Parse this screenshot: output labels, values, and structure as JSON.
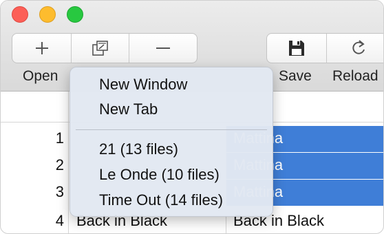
{
  "window": {
    "traffic_lights": [
      "close",
      "minimize",
      "zoom"
    ]
  },
  "toolbar": {
    "left_group": [
      {
        "name": "add",
        "icon": "plus-icon"
      },
      {
        "name": "open",
        "icon": "open-window-icon"
      },
      {
        "name": "remove",
        "icon": "minus-icon"
      }
    ],
    "right_group": [
      {
        "name": "save",
        "icon": "floppy-disk-icon"
      },
      {
        "name": "reload",
        "icon": "reload-icon"
      }
    ],
    "labels": {
      "open": "Open",
      "save": "Save",
      "reload": "Reload"
    }
  },
  "menu": {
    "items_top": [
      "New Window",
      "New Tab"
    ],
    "items_bottom": [
      "21 (13 files)",
      "Le Onde (10 files)",
      "Time Out (14 files)"
    ]
  },
  "table": {
    "rows": [
      {
        "num": "1",
        "col2": "",
        "col3": "Mattina",
        "selected": true
      },
      {
        "num": "2",
        "col2": "",
        "col3": "Mattina",
        "selected": true
      },
      {
        "num": "3",
        "col2": "",
        "col3": "Mattina",
        "selected": true
      },
      {
        "num": "4",
        "col2": "Back in Black",
        "col3": "Back in Black",
        "selected": false
      }
    ]
  },
  "colors": {
    "selection": "#3f7ed7",
    "menu_bg": "#e2e8f2"
  }
}
